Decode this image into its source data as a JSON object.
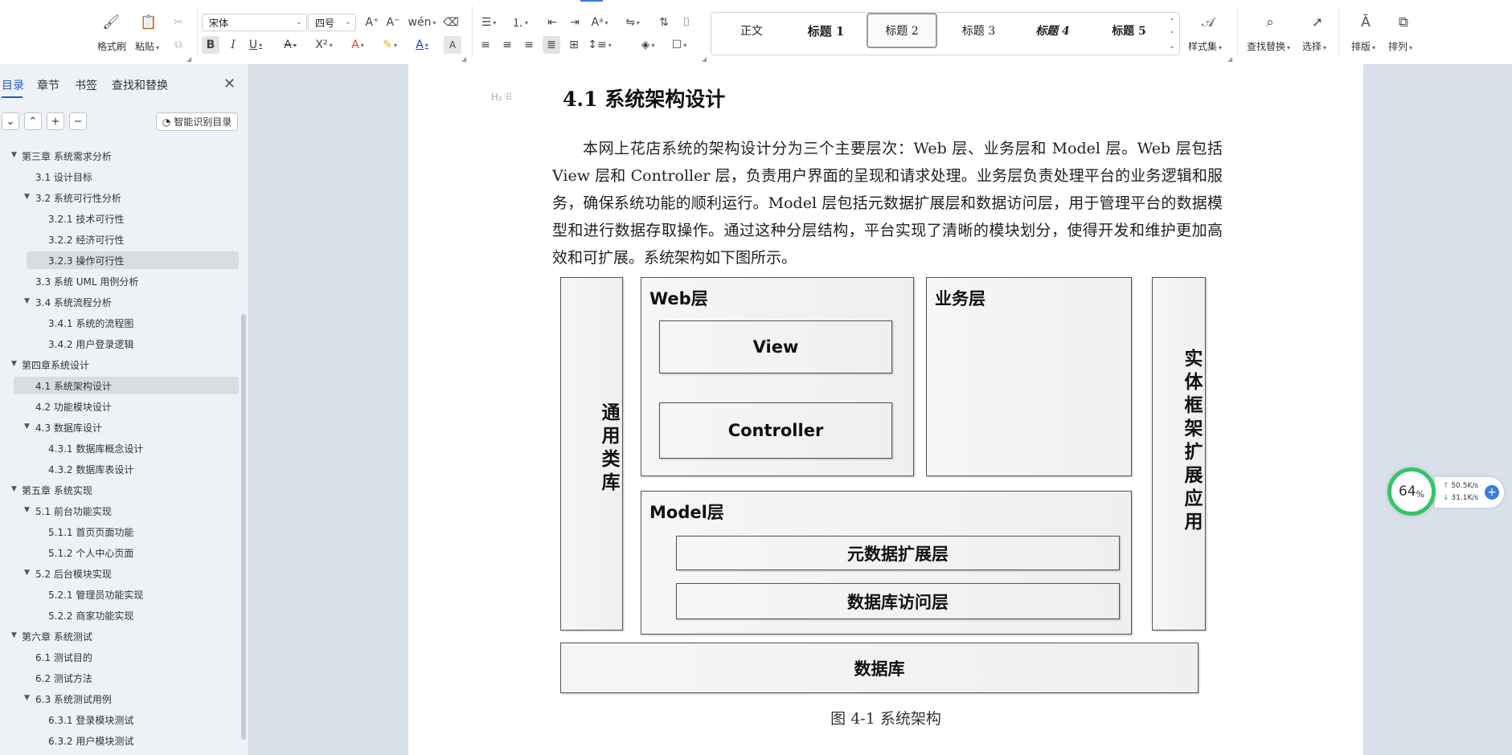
{
  "ribbon": {
    "clipboard": {
      "format_painter": "格式刷",
      "paste": "粘贴"
    },
    "font": {
      "name": "宋体",
      "size": "四号"
    },
    "styles": [
      "正文",
      "标题 1",
      "标题 2",
      "标题 3",
      "标题 4",
      "标题 5"
    ],
    "selected_style": "标题 2",
    "style_set": "样式集",
    "find_replace": "查找替换",
    "select": "选择",
    "layout": "排版",
    "arrange": "排列",
    "icons": [
      "paste-icon",
      "format-painter-icon",
      "cut-icon",
      "copy-icon",
      "bold-icon",
      "italic-icon",
      "underline-icon",
      "strikethrough-icon",
      "superscript-icon",
      "font-color-icon",
      "highlight-icon",
      "bullet-list-icon",
      "numbered-list-icon",
      "align-left-icon",
      "align-center-icon",
      "align-right-icon",
      "justify-icon",
      "search-icon",
      "cursor-icon"
    ]
  },
  "sidebar": {
    "tabs": [
      "目录",
      "章节",
      "书签",
      "查找和替换"
    ],
    "active_tab": "目录",
    "smart_toc": "智能识别目录",
    "toc": [
      {
        "label": "第三章  系统需求分析",
        "level": 0,
        "arrow": true
      },
      {
        "label": "3.1 设计目标",
        "level": 1,
        "arrow": false
      },
      {
        "label": "3.2 系统可行性分析",
        "level": 1,
        "arrow": true
      },
      {
        "label": "3.2.1 技术可行性",
        "level": 2,
        "arrow": false
      },
      {
        "label": "3.2.2 经济可行性",
        "level": 2,
        "arrow": false
      },
      {
        "label": "3.2.3 操作可行性",
        "level": 2,
        "arrow": false,
        "highlight": true
      },
      {
        "label": "3.3 系统 UML 用例分析",
        "level": 1,
        "arrow": false
      },
      {
        "label": "3.4 系统流程分析",
        "level": 1,
        "arrow": true
      },
      {
        "label": "3.4.1 系统的流程图",
        "level": 2,
        "arrow": false
      },
      {
        "label": "3.4.2 用户登录逻辑",
        "level": 2,
        "arrow": false
      },
      {
        "label": "第四章系统设计",
        "level": 0,
        "arrow": true
      },
      {
        "label": "4.1  系统架构设计",
        "level": 1,
        "arrow": false,
        "highlight": true
      },
      {
        "label": "4.2 功能模块设计",
        "level": 1,
        "arrow": false
      },
      {
        "label": "4.3  数据库设计",
        "level": 1,
        "arrow": true
      },
      {
        "label": "4.3.1 数据库概念设计",
        "level": 2,
        "arrow": false
      },
      {
        "label": "4.3.2  数据库表设计",
        "level": 2,
        "arrow": false
      },
      {
        "label": "第五章  系统实现",
        "level": 0,
        "arrow": true
      },
      {
        "label": "5.1 前台功能实现",
        "level": 1,
        "arrow": true
      },
      {
        "label": "5.1.1 首页页面功能",
        "level": 2,
        "arrow": false
      },
      {
        "label": "5.1.2 个人中心页面",
        "level": 2,
        "arrow": false
      },
      {
        "label": "5.2 后台模块实现",
        "level": 1,
        "arrow": true
      },
      {
        "label": "5.2.1 管理员功能实现",
        "level": 2,
        "arrow": false
      },
      {
        "label": "5.2.2 商家功能实现",
        "level": 2,
        "arrow": false
      },
      {
        "label": "第六章  系统测试",
        "level": 0,
        "arrow": true
      },
      {
        "label": "6.1 测试目的",
        "level": 1,
        "arrow": false
      },
      {
        "label": "6.2 测试方法",
        "level": 1,
        "arrow": false
      },
      {
        "label": "6.3 系统测试用例",
        "level": 1,
        "arrow": true
      },
      {
        "label": "6.3.1 登录模块测试",
        "level": 2,
        "arrow": false
      },
      {
        "label": "6.3.2 用户模块测试",
        "level": 2,
        "arrow": false
      }
    ]
  },
  "document": {
    "heading_marker": "H₂",
    "heading": "4.1  系统架构设计",
    "paragraph": "本网上花店系统的架构设计分为三个主要层次：Web 层、业务层和 Model 层。Web 层包括 View 层和 Controller 层，负责用户界面的呈现和请求处理。业务层负责处理平台的业务逻辑和服务，确保系统功能的顺利运行。Model 层包括元数据扩展层和数据访问层，用于管理平台的数据模型和进行数据存取操作。通过这种分层结构，平台实现了清晰的模块划分，使得开发和维护更加高效和可扩展。系统架构如下图所示。",
    "diagram": {
      "common_lib": "通用类库",
      "web_layer": "Web层",
      "view": "View",
      "controller": "Controller",
      "business_layer": "业务层",
      "entity_framework": "实体框架扩展应用",
      "model_layer": "Model层",
      "metadata_layer": "元数据扩展层",
      "db_access_layer": "数据库访问层",
      "database": "数据库"
    },
    "caption": "图 4-1  系统架构"
  },
  "widget": {
    "percent": "64",
    "percent_sign": "%",
    "upload": "50.5K/s",
    "download": "31.1K/s"
  }
}
